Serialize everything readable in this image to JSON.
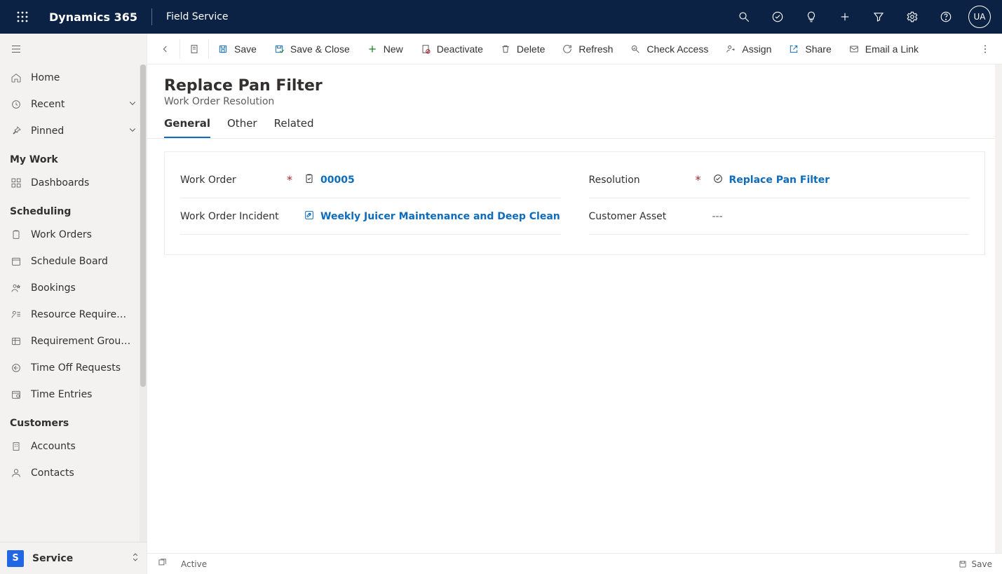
{
  "header": {
    "brand": "Dynamics 365",
    "app": "Field Service",
    "avatar": "UA"
  },
  "sidebar": {
    "top": [
      {
        "label": "Home"
      },
      {
        "label": "Recent"
      },
      {
        "label": "Pinned"
      }
    ],
    "groups": [
      {
        "title": "My Work",
        "items": [
          {
            "label": "Dashboards"
          }
        ]
      },
      {
        "title": "Scheduling",
        "items": [
          {
            "label": "Work Orders"
          },
          {
            "label": "Schedule Board"
          },
          {
            "label": "Bookings"
          },
          {
            "label": "Resource Require…"
          },
          {
            "label": "Requirement Grou…"
          },
          {
            "label": "Time Off Requests"
          },
          {
            "label": "Time Entries"
          }
        ]
      },
      {
        "title": "Customers",
        "items": [
          {
            "label": "Accounts"
          },
          {
            "label": "Contacts"
          }
        ]
      }
    ],
    "area": {
      "badge": "S",
      "label": "Service"
    }
  },
  "commands": {
    "save": "Save",
    "save_close": "Save & Close",
    "new": "New",
    "deactivate": "Deactivate",
    "delete": "Delete",
    "refresh": "Refresh",
    "check_access": "Check Access",
    "assign": "Assign",
    "share": "Share",
    "email_link": "Email a Link"
  },
  "page": {
    "title": "Replace Pan Filter",
    "subtitle": "Work Order Resolution"
  },
  "tabs": [
    {
      "label": "General",
      "active": true
    },
    {
      "label": "Other"
    },
    {
      "label": "Related"
    }
  ],
  "form": {
    "work_order": {
      "label": "Work Order",
      "required": true,
      "value": "00005"
    },
    "resolution": {
      "label": "Resolution",
      "required": true,
      "value": "Replace Pan Filter"
    },
    "incident": {
      "label": "Work Order Incident",
      "value": "Weekly Juicer Maintenance and Deep Clean"
    },
    "asset": {
      "label": "Customer Asset",
      "value": "---"
    }
  },
  "footer": {
    "status": "Active",
    "save": "Save"
  }
}
